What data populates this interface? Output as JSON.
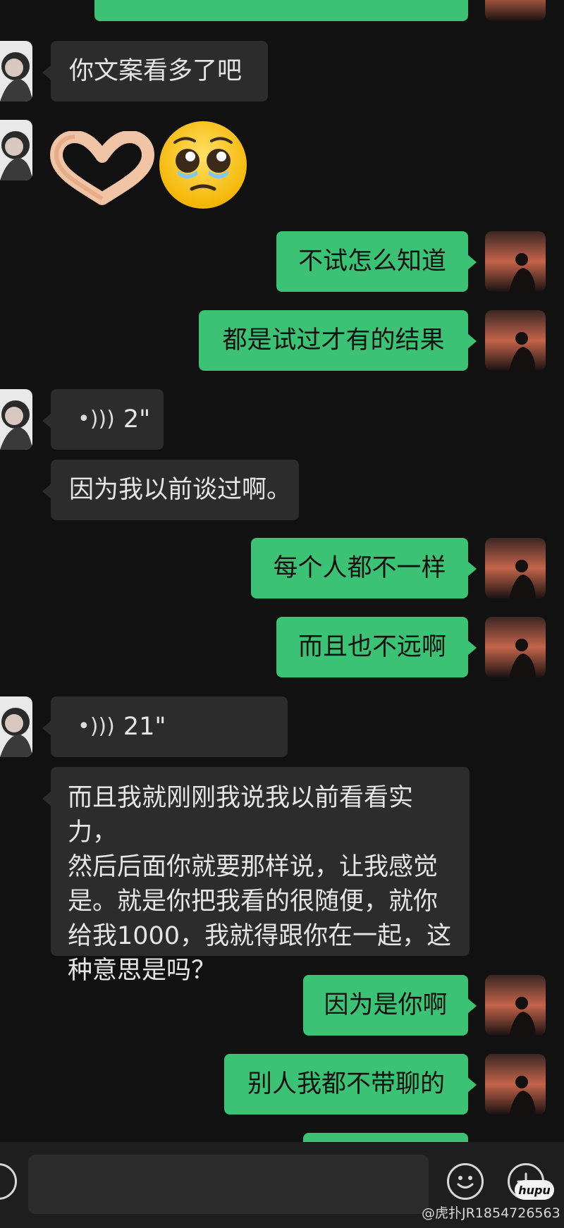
{
  "messages": [
    {
      "side": "in",
      "text": "你文案看多了吧"
    },
    {
      "side": "out",
      "text": "不试怎么知道"
    },
    {
      "side": "out",
      "text": "都是试过才有的结果"
    },
    {
      "side": "in",
      "type": "voice",
      "duration": "2\""
    },
    {
      "side": "in",
      "text": "因为我以前谈过啊。"
    },
    {
      "side": "out",
      "text": "每个人都不一样"
    },
    {
      "side": "out",
      "text": "而且也不远啊"
    },
    {
      "side": "in",
      "type": "voice",
      "duration": "21\""
    },
    {
      "side": "in",
      "lines": [
        "而且我就刚刚我说我以前看看实力，",
        "然后后面你就要那样说，让我感觉",
        "是。就是你把我看的很随便，就你",
        "给我1000，我就得跟你在一起，这",
        "种意思是吗？"
      ]
    },
    {
      "side": "out",
      "text": "因为是你啊"
    },
    {
      "side": "out",
      "text": "别人我都不带聊的"
    }
  ],
  "emoji_message": {
    "side": "in",
    "emojis": [
      "heart-hands",
      "pleading-face"
    ]
  },
  "watermark": "@虎扑JR1854726563",
  "logo_text": "hupu",
  "colors": {
    "background": "#111111",
    "outgoing": "#3cc274",
    "incoming": "#2c2c2c"
  }
}
